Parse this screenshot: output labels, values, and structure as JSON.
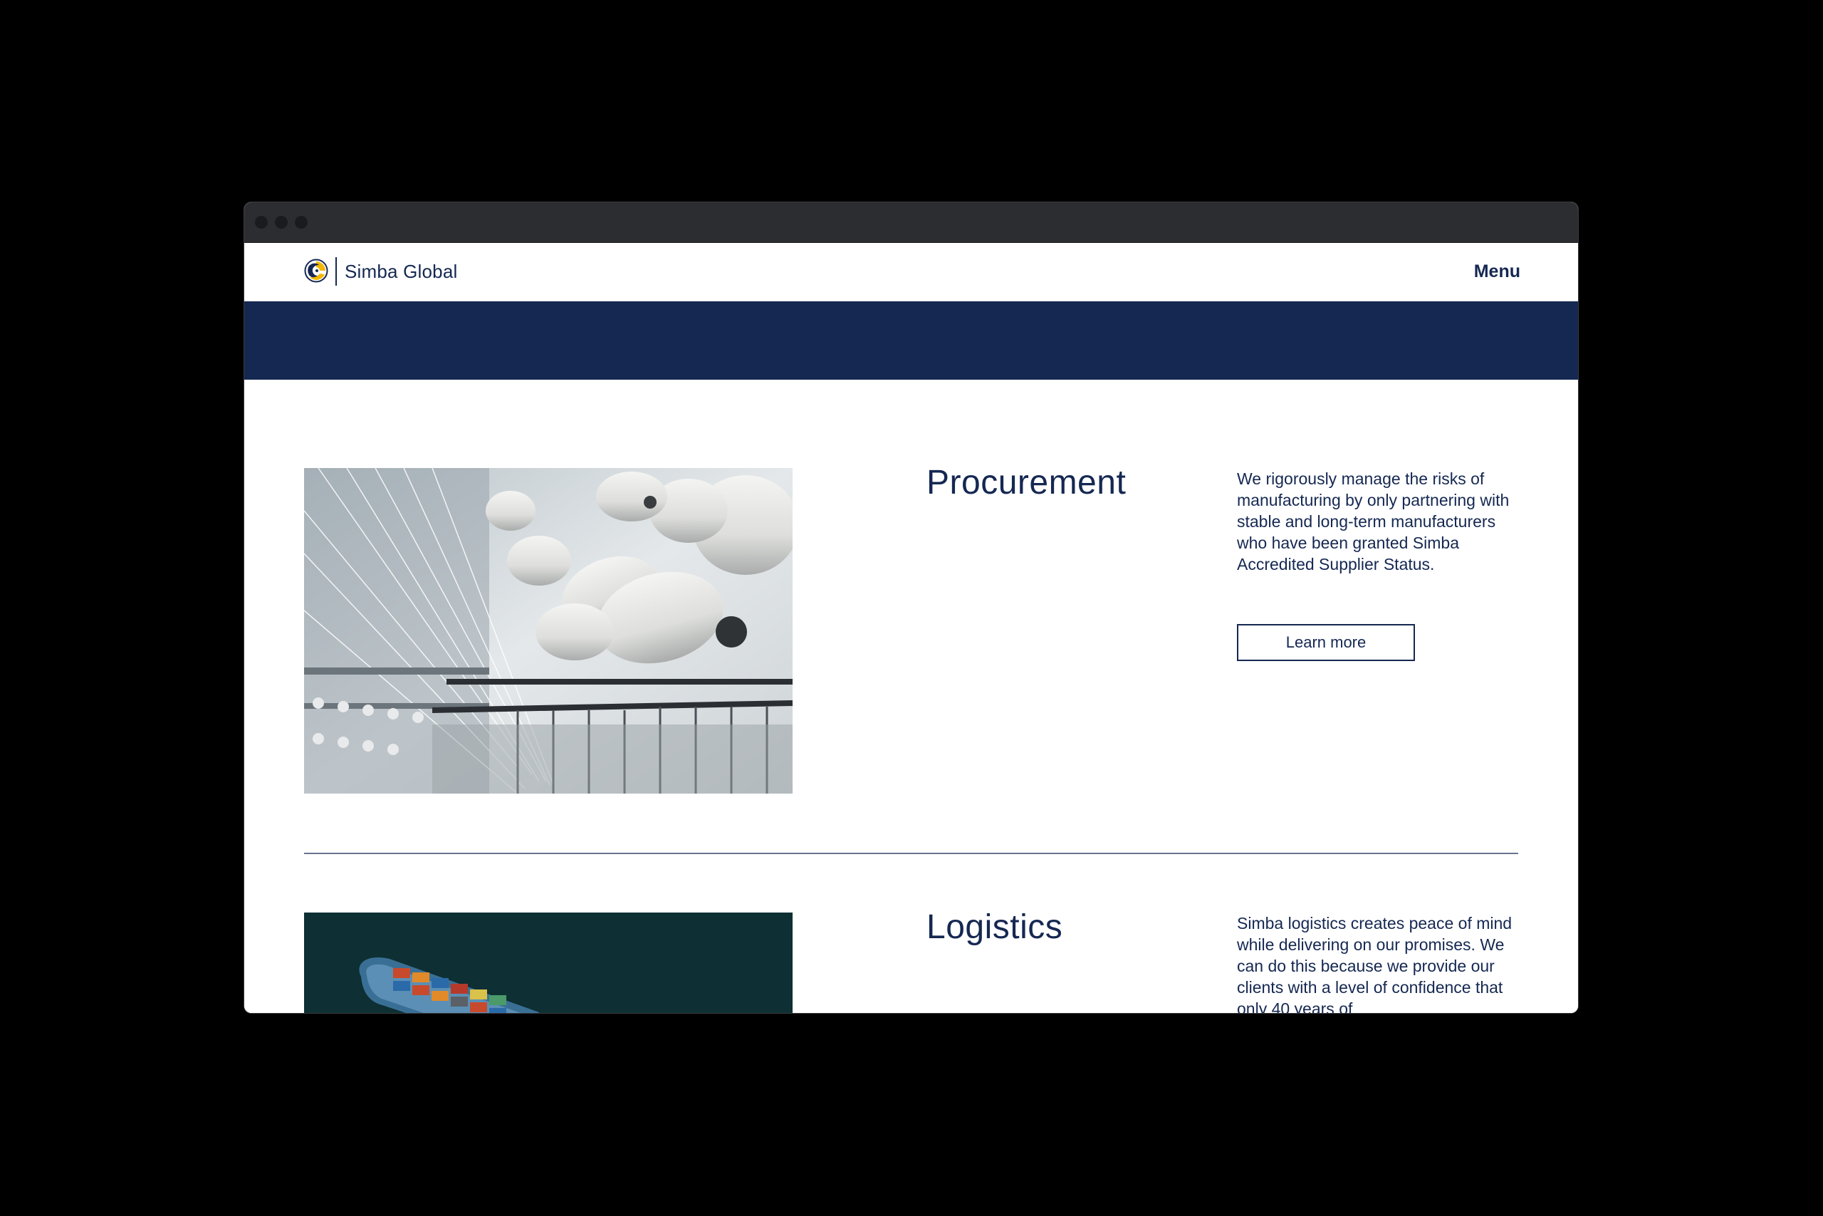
{
  "header": {
    "brand": "Simba Global",
    "menu_label": "Menu"
  },
  "icons": {
    "logo": "simba-lion-logo-icon"
  },
  "colors": {
    "brand_navy": "#152852",
    "logo_gold": "#f2b800",
    "page_background": "#ffffff"
  },
  "sections": [
    {
      "title": "Procurement",
      "text": "We rigorously manage the risks of manufacturing by only partnering with stable and long-term manufacturers who have been granted Simba Accredited Supplier Status.",
      "button": "Learn more",
      "image": "textile-spools-photo"
    },
    {
      "title": "Logistics",
      "text": "Simba logistics creates peace of mind while delivering on our promises. We can do this because we provide our clients with a level of confidence that only 40 years of",
      "image": "container-ship-aerial-photo"
    }
  ]
}
